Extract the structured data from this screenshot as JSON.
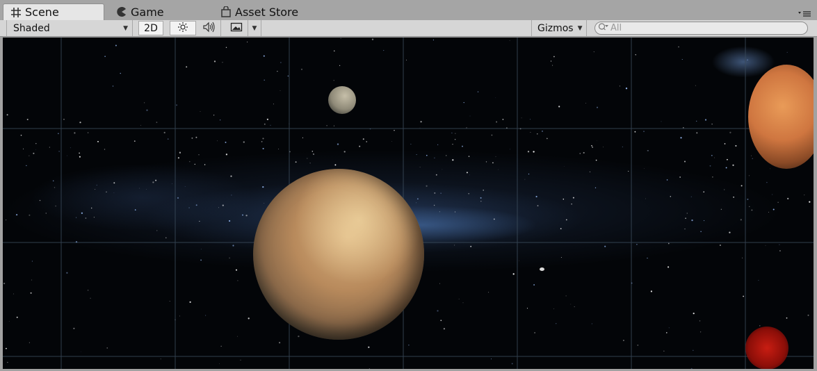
{
  "tabs": [
    {
      "label": "Scene",
      "icon": "grid-icon",
      "active": true
    },
    {
      "label": "Game",
      "icon": "pacman-icon",
      "active": false
    },
    {
      "label": "Asset Store",
      "icon": "shopping-bag-icon",
      "active": false
    }
  ],
  "toolbar": {
    "shading_mode": "Shaded",
    "mode_2d_label": "2D",
    "lighting_icon": "sun-icon",
    "audio_icon": "speaker-icon",
    "effects_icon": "image-icon",
    "gizmos_label": "Gizmos",
    "search_placeholder": "All"
  },
  "scene": {
    "objects": [
      {
        "name": "large-tan-planet",
        "color": "#c59a6b"
      },
      {
        "name": "small-moon",
        "color": "#a49e8a"
      },
      {
        "name": "mars-planet",
        "color": "#d27c44"
      },
      {
        "name": "red-glow-object",
        "color": "#b3180f"
      },
      {
        "name": "asteroid",
        "color": "#d9d9d9"
      }
    ],
    "background_color": "#030508",
    "grid_color": "#3a4a5a"
  }
}
